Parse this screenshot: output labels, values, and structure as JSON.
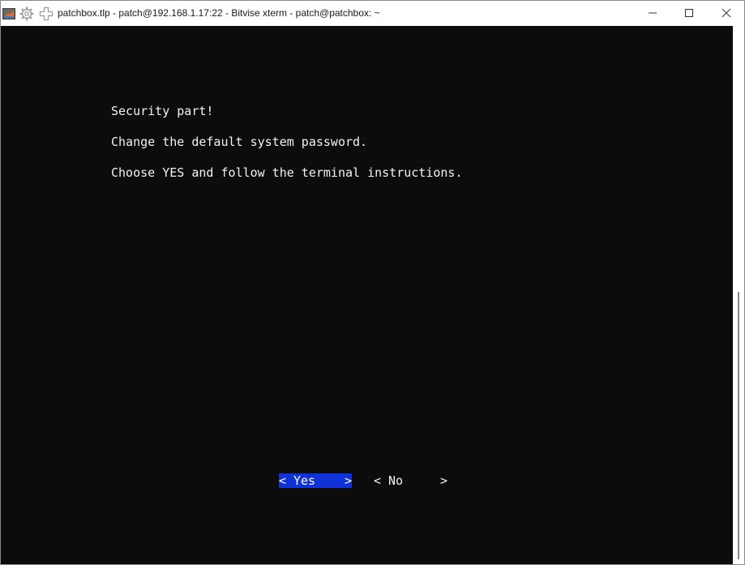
{
  "window": {
    "title": "patchbox.tlp - patch@192.168.1.17:22 - Bitvise xterm - patch@patchbox: ~",
    "icons": [
      "app-icon",
      "gear-icon",
      "plus-icon"
    ],
    "controls": [
      "minimize-icon",
      "maximize-icon",
      "close-icon"
    ]
  },
  "terminal": {
    "background": "#0c0c0c",
    "foreground": "#f2f2f2",
    "lines": [
      "Security part!",
      "Change the default system password.",
      "Choose YES and follow the terminal instructions."
    ]
  },
  "dialog": {
    "selected_color": "#1033d8",
    "buttons": [
      {
        "open": "<",
        "label": "Yes",
        "close": ">",
        "selected": true
      },
      {
        "open": "<",
        "label": "No",
        "close": ">",
        "selected": false
      }
    ]
  }
}
